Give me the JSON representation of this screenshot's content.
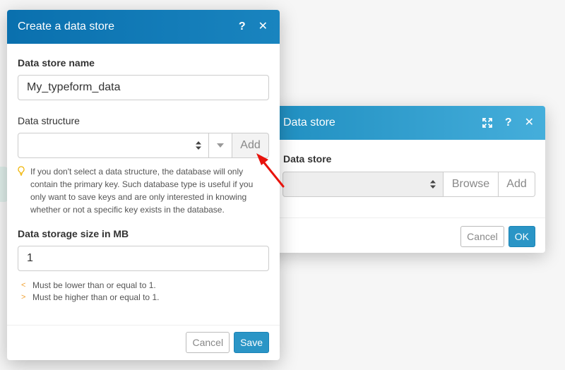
{
  "create_dialog": {
    "title": "Create a data store",
    "name_label": "Data store name",
    "name_value": "My_typeform_data",
    "structure_label": "Data structure",
    "structure_value": "",
    "add_label": "Add",
    "hint_text": "If you don't select a data structure, the database will only contain the primary key. Such database type is useful if you only want to save keys and are only interested in knowing whether or not a specific key exists in the database.",
    "size_label": "Data storage size in MB",
    "size_value": "1",
    "rules": [
      {
        "text": "Must be lower than or equal to 1."
      },
      {
        "text": "Must be higher than or equal to 1."
      }
    ],
    "cancel_label": "Cancel",
    "save_label": "Save"
  },
  "data_store_dialog": {
    "title": "Data store",
    "field_label": "Data store",
    "select_value": "",
    "browse_label": "Browse",
    "add_label": "Add",
    "cancel_label": "Cancel",
    "ok_label": "OK"
  },
  "icons": {
    "help": "help-icon",
    "close": "close-icon",
    "expand": "expand-icon",
    "hint": "lightbulb-icon",
    "annotation": "red-arrow"
  },
  "colors": {
    "front_header": "#0a70ae",
    "back_header": "#2a95c6",
    "primary_button": "#2a95c6",
    "hint_bulb": "#f0b400",
    "rule_chevron": "#f0a030",
    "annotation_arrow": "#e8130c"
  }
}
